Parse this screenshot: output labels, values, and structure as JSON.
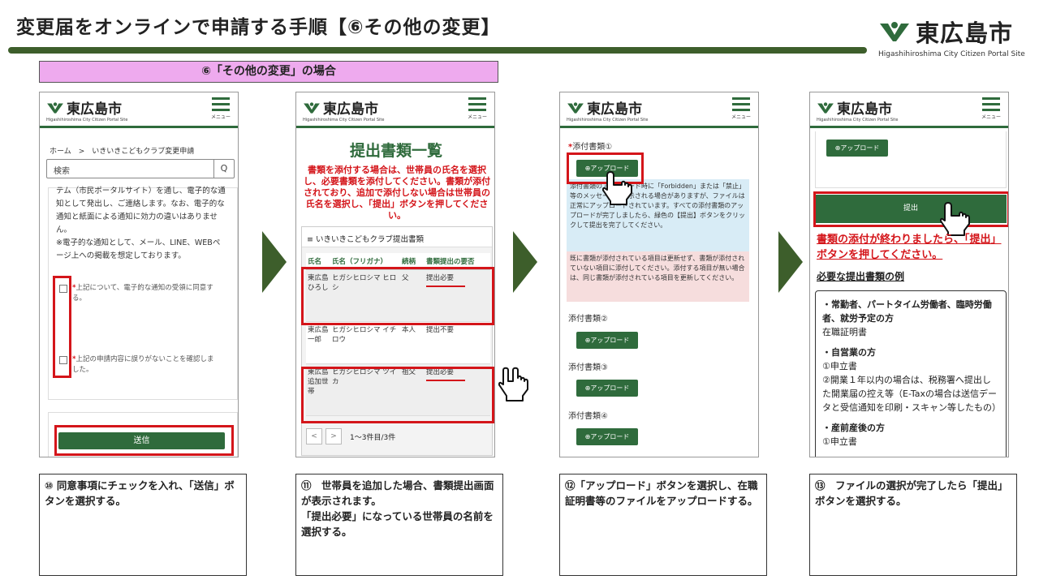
{
  "title": "変更届をオンラインで申請する手順【⑥その他の変更】",
  "logo": {
    "name": "東広島市",
    "sub": "Higashihiroshima City Citizen Portal Site"
  },
  "section_label": "⑥「その他の変更」の場合",
  "phone": {
    "logo_name": "東広島市",
    "logo_sub": "Higashihiroshima City Citizen Portal Site",
    "menu_label": "メニュー"
  },
  "phone1": {
    "breadcrumb": "ホーム　>　いきいきこどもクラブ変更申請",
    "search_placeholder": "検索",
    "search_icon": "Q",
    "body_text": "テム（市民ポータルサイト）を通し、電子的な通知として発出し、ご連絡します。なお、電子的な通知と紙面による通知に効力の違いはありません。\n※電子的な通知として、メール、LINE、WEBページ上への掲載を想定しております。",
    "check1": "上記について、電子的な通知の受領に同意する。",
    "check2": "上記の申請内容に誤りがないことを確認しました。",
    "required_mark": "*",
    "send_label": "送信"
  },
  "phone2": {
    "heading": "提出書類一覧",
    "notice": "書類を添付する場合は、世帯員の氏名を選択し、必要書類を添付してください。書類が添付されており、追加で添付しない場合は世帯員の氏名を選択し、「提出」ボタンを押してください。",
    "list_title": "≡ いきいきこどもクラブ提出書類",
    "columns": [
      "氏名",
      "氏名（フリガナ）",
      "続柄",
      "書類提出の要否"
    ],
    "rows": [
      {
        "name": "東広島ひろし",
        "kana": "ヒガシヒロシマ ヒロシ",
        "rel": "父",
        "req": "提出必要"
      },
      {
        "name": "東広島一郎",
        "kana": "ヒガシヒロシマ イチロウ",
        "rel": "本人",
        "req": "提出不要"
      },
      {
        "name": "東広島追加世帯",
        "kana": "ヒガシヒロシマ ツイカ",
        "rel": "祖父",
        "req": "提出必要"
      }
    ],
    "pager_prev": "<",
    "pager_next": ">",
    "pager_text": "1～3件目/3件"
  },
  "phone3": {
    "required_mark": "*",
    "attach1": "添付書類①",
    "attach2": "添付書類②",
    "attach3": "添付書類③",
    "attach4": "添付書類④",
    "upload_label": "⊕アップロード",
    "info_blue": "添付書類のアップロード時に「Forbidden」または「禁止」等のメッセージが表示される場合がありますが、ファイルは正常にアップロードされています。すべての添付書類のアップロードが完了しましたら、緑色の【提出】ボタンをクリックして提出を完了してください。",
    "info_pink": "既に書類が添付されている項目は更新せず、書類が添付されていない項目に添付してください。添付する項目が無い場合は、同じ書類が添付されている項目を更新してください。"
  },
  "phone4": {
    "upload_label": "⊕アップロード",
    "submit_label": "提出",
    "red_text": "書類の添付が終わりましたら、「提出」ボタンを押してください。",
    "heading": "必要な提出書類の例",
    "ex1_title": "・常勤者、パートタイム労働者、臨時労働者、就労予定の方",
    "ex1_body": "在職証明書",
    "ex2_title": "・自営業の方",
    "ex2_body1": "①申立書",
    "ex2_body2": "②開業１年以内の場合は、税務署へ提出した開業届の控え等（E-Taxの場合は送信データと受信通知を印刷・スキャン等したもの）",
    "ex3_title": "・産前産後の方",
    "ex3_body": "①申立書"
  },
  "captions": [
    "⑩ 同意事項にチェックを入れ、「送信」ボタンを選択する。",
    "⑪　世帯員を追加した場合、書類提出画面が表示されます。\n「提出必要」になっている世帯員の名前を選択する。",
    "⑫「アップロード」ボタンを選択し、在職証明書等のファイルをアップロードする。",
    "⑬　ファイルの選択が完了したら「提出」ボタンを選択する。"
  ],
  "colors": {
    "brand_green": "#2f6b3c",
    "accent_red": "#d4151a",
    "section_pink": "#eeaaee"
  }
}
